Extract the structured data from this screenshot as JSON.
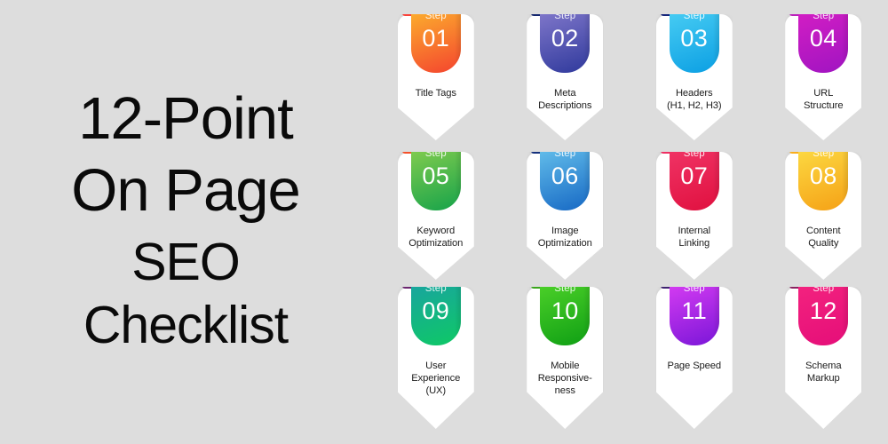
{
  "background_color": "#dddddd",
  "title": {
    "line1": "12-Point",
    "line2": "On Page",
    "line3": "SEO",
    "line4": "Checklist",
    "color": "#0a0a0a"
  },
  "steps": [
    {
      "step_label": "Step",
      "number": "01",
      "title_line1": "Title Tags",
      "title_line2": "",
      "title_line3": "",
      "gradient_from": "#fdbb2d",
      "gradient_to": "#f4442e",
      "tab_color": "#f9423a"
    },
    {
      "step_label": "Step",
      "number": "02",
      "title_line1": "Meta",
      "title_line2": "Descriptions",
      "title_line3": "",
      "gradient_from": "#8a7fd0",
      "gradient_to": "#2f399c",
      "tab_color": "#13266e"
    },
    {
      "step_label": "Step",
      "number": "03",
      "title_line1": "Headers",
      "title_line2": "(H1, H2, H3)",
      "title_line3": "",
      "gradient_from": "#4fd2f5",
      "gradient_to": "#0b9fe3",
      "tab_color": "#14257a"
    },
    {
      "step_label": "Step",
      "number": "04",
      "title_line1": "URL",
      "title_line2": "Structure",
      "title_line3": "",
      "gradient_from": "#d91fc4",
      "gradient_to": "#a014c1",
      "tab_color": "#bb22bb"
    },
    {
      "step_label": "Step",
      "number": "05",
      "title_line1": "Keyword",
      "title_line2": "Optimization",
      "title_line3": "",
      "gradient_from": "#8fd14f",
      "gradient_to": "#16a34a",
      "tab_color": "#f4502a"
    },
    {
      "step_label": "Step",
      "number": "06",
      "title_line1": "Image",
      "title_line2": "Optimization",
      "title_line3": "",
      "gradient_from": "#6cc8ef",
      "gradient_to": "#1668c4",
      "tab_color": "#15307d"
    },
    {
      "step_label": "Step",
      "number": "07",
      "title_line1": "Internal",
      "title_line2": "Linking",
      "title_line3": "",
      "gradient_from": "#f2386a",
      "gradient_to": "#e0103f",
      "tab_color": "#ef2f62"
    },
    {
      "step_label": "Step",
      "number": "08",
      "title_line1": "Content",
      "title_line2": "Quality",
      "title_line3": "",
      "gradient_from": "#fde047",
      "gradient_to": "#f5a116",
      "tab_color": "#f9ad1d"
    },
    {
      "step_label": "Step",
      "number": "09",
      "title_line1": "User",
      "title_line2": "Experience",
      "title_line3": "(UX)",
      "gradient_from": "#1aa0a6",
      "gradient_to": "#0ec965",
      "tab_color": "#6b2670"
    },
    {
      "step_label": "Step",
      "number": "10",
      "title_line1": "Mobile",
      "title_line2": "Responsive-",
      "title_line3": "ness",
      "gradient_from": "#53d62b",
      "gradient_to": "#0f9f14",
      "tab_color": "#3aa61c"
    },
    {
      "step_label": "Step",
      "number": "11",
      "title_line1": "Page Speed",
      "title_line2": "",
      "title_line3": "",
      "gradient_from": "#e040f5",
      "gradient_to": "#7a16d8",
      "tab_color": "#3e2370"
    },
    {
      "step_label": "Step",
      "number": "12",
      "title_line1": "Schema",
      "title_line2": "Markup",
      "title_line3": "",
      "gradient_from": "#f5257f",
      "gradient_to": "#e50e79",
      "tab_color": "#8b2360"
    }
  ]
}
